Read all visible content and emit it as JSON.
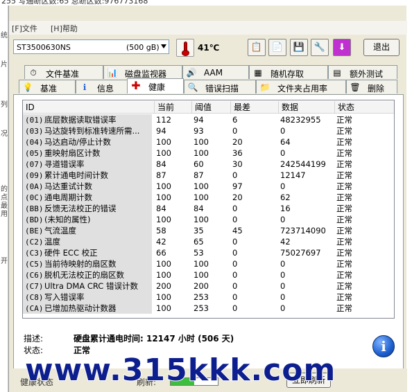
{
  "background_window": {
    "top_text": "255   写通断区数:65   总断区数:976773168",
    "left_chars": [
      "统",
      "片",
      "列",
      "况",
      "的",
      "点",
      "最",
      "用",
      "开"
    ]
  },
  "menu": [
    {
      "label": "[F]文件"
    },
    {
      "label": "[H]帮助"
    }
  ],
  "toolbar": {
    "drive_model": "ST3500630NS",
    "drive_capacity": "(500 gB)",
    "temperature": "41℃",
    "buttons": [
      {
        "icon": "copy-icon",
        "glyph": "📋"
      },
      {
        "icon": "paste-icon",
        "glyph": "📄"
      },
      {
        "icon": "save-icon",
        "glyph": "💾"
      },
      {
        "icon": "settings-icon",
        "glyph": "🔧"
      },
      {
        "icon": "download-icon",
        "glyph": "⬇"
      }
    ],
    "exit_label": "退出"
  },
  "tabs_row1": [
    {
      "label": "文件基准",
      "icon": "stopwatch-icon",
      "glyph": "⏱"
    },
    {
      "label": "磁盘监视器",
      "icon": "chart-icon",
      "glyph": "📊"
    },
    {
      "label": "AAM",
      "icon": "speaker-icon",
      "glyph": "🔊"
    },
    {
      "label": "随机存取",
      "icon": "dots-grid-icon",
      "glyph": "▦"
    },
    {
      "label": "额外测试",
      "icon": "gauge-icon",
      "glyph": "▤"
    }
  ],
  "tabs_row2": [
    {
      "label": "基准",
      "icon": "lightbulb-icon",
      "glyph": "💡"
    },
    {
      "label": "信息",
      "icon": "info-icon",
      "glyph": "ℹ"
    },
    {
      "label": "健康",
      "icon": "health-cross-icon",
      "glyph": "✚",
      "active": true
    },
    {
      "label": "错误扫描",
      "icon": "magnifier-icon",
      "glyph": "🔍"
    },
    {
      "label": "文件夹占用率",
      "icon": "folder-icon",
      "glyph": "📁"
    },
    {
      "label": "删除",
      "icon": "trash-icon",
      "glyph": "🗑"
    }
  ],
  "columns": {
    "id": "ID",
    "current": "当前",
    "threshold": "阈值",
    "worst": "最差",
    "data": "数据",
    "status": "状态"
  },
  "rows": [
    {
      "code": "(01)",
      "name": "底层数据读取错误率",
      "current": "112",
      "threshold": "94",
      "worst": "6",
      "data": "48232955",
      "status": "正常"
    },
    {
      "code": "(03)",
      "name": "马达旋转到标准转速所需...",
      "current": "94",
      "threshold": "93",
      "worst": "0",
      "data": "0",
      "status": "正常"
    },
    {
      "code": "(04)",
      "name": "马达启动/停止计数",
      "current": "100",
      "threshold": "100",
      "worst": "20",
      "data": "64",
      "status": "正常"
    },
    {
      "code": "(05)",
      "name": "重映射扇区计数",
      "current": "100",
      "threshold": "100",
      "worst": "36",
      "data": "0",
      "status": "正常"
    },
    {
      "code": "(07)",
      "name": "寻道错误率",
      "current": "84",
      "threshold": "60",
      "worst": "30",
      "data": "242544199",
      "status": "正常"
    },
    {
      "code": "(09)",
      "name": "累计通电时间计数",
      "current": "87",
      "threshold": "87",
      "worst": "0",
      "data": "12147",
      "status": "正常"
    },
    {
      "code": "(0A)",
      "name": "马达重试计数",
      "current": "100",
      "threshold": "100",
      "worst": "97",
      "data": "0",
      "status": "正常"
    },
    {
      "code": "(0C)",
      "name": "通电周期计数",
      "current": "100",
      "threshold": "100",
      "worst": "20",
      "data": "62",
      "status": "正常"
    },
    {
      "code": "(BB)",
      "name": "反馈无法校正的错误",
      "current": "84",
      "threshold": "84",
      "worst": "0",
      "data": "16",
      "status": "正常"
    },
    {
      "code": "(BD)",
      "name": "(未知的属性)",
      "current": "100",
      "threshold": "100",
      "worst": "0",
      "data": "0",
      "status": "正常"
    },
    {
      "code": "(BE)",
      "name": "气流温度",
      "current": "58",
      "threshold": "35",
      "worst": "45",
      "data": "723714090",
      "status": "正常"
    },
    {
      "code": "(C2)",
      "name": "温度",
      "current": "42",
      "threshold": "65",
      "worst": "0",
      "data": "42",
      "status": "正常"
    },
    {
      "code": "(C3)",
      "name": "硬件 ECC 校正",
      "current": "66",
      "threshold": "53",
      "worst": "0",
      "data": "75027697",
      "status": "正常"
    },
    {
      "code": "(C5)",
      "name": "当前待映射的扇区数",
      "current": "100",
      "threshold": "100",
      "worst": "0",
      "data": "0",
      "status": "正常"
    },
    {
      "code": "(C6)",
      "name": "脱机无法校正的扇区数",
      "current": "100",
      "threshold": "100",
      "worst": "0",
      "data": "0",
      "status": "正常"
    },
    {
      "code": "(C7)",
      "name": "Ultra DMA CRC 错误计数",
      "current": "200",
      "threshold": "200",
      "worst": "0",
      "data": "0",
      "status": "正常"
    },
    {
      "code": "(C8)",
      "name": "写入错误率",
      "current": "100",
      "threshold": "253",
      "worst": "0",
      "data": "0",
      "status": "正常"
    },
    {
      "code": "(CA)",
      "name": "已增加热驱动计数器",
      "current": "100",
      "threshold": "253",
      "worst": "0",
      "data": "0",
      "status": "正常"
    }
  ],
  "details": {
    "desc_label": "描述:",
    "desc_text": "硬盘累计通电时间: 12147 小时 (506 天)",
    "status_label": "状态:",
    "status_text": "正常"
  },
  "bottom": {
    "health_label": "健康状态",
    "refresh_label": "刷新:",
    "refresh_progress": 0.5,
    "now_label": "立即刷新"
  },
  "watermark": "www.315kkk.com",
  "colors": {
    "window_bg": "#ece9d8",
    "id_cell_bg": "#e0e0e0",
    "health_icon_red": "#cc0000",
    "info_blue": "#1d5fcf",
    "watermark": "#0d1e8e"
  }
}
